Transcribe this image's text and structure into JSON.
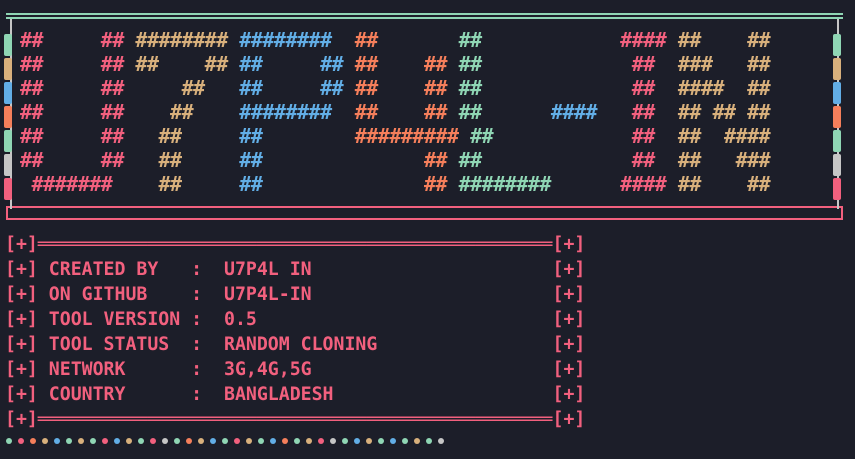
{
  "palette": {
    "background": "#1c1e29",
    "pink": "#f2607e",
    "tan": "#d8b07c",
    "blue": "#62aee6",
    "orange": "#f57f5b",
    "green": "#8fd6b4",
    "gray": "#c6c6c6",
    "accent": "#f2607e"
  },
  "side_bar_colors": [
    "#8fd6b4",
    "#d8b07c",
    "#62aee6",
    "#f57f5b",
    "#8fd6b4",
    "#c6c6c6",
    "#f2607e"
  ],
  "banner": {
    "rows": [
      [
        {
          "text": "##     ## ",
          "color": "#f2607e"
        },
        {
          "text": "######## ",
          "color": "#d8b07c"
        },
        {
          "text": "########  ",
          "color": "#62aee6"
        },
        {
          "text": "##       ",
          "color": "#f57f5b"
        },
        {
          "text": "##            ",
          "color": "#8fd6b4"
        },
        {
          "text": "####",
          "color": "#f2607e"
        },
        {
          "text": " ##    ##",
          "color": "#d8b07c"
        }
      ],
      [
        {
          "text": "##     ## ",
          "color": "#f2607e"
        },
        {
          "text": "##    ## ",
          "color": "#d8b07c"
        },
        {
          "text": "##     ## ",
          "color": "#62aee6"
        },
        {
          "text": "##    ## ",
          "color": "#f57f5b"
        },
        {
          "text": "##             ",
          "color": "#8fd6b4"
        },
        {
          "text": "##",
          "color": "#f2607e"
        },
        {
          "text": "  ###   ##",
          "color": "#d8b07c"
        }
      ],
      [
        {
          "text": "##     ## ",
          "color": "#f2607e"
        },
        {
          "text": "    ##   ",
          "color": "#d8b07c"
        },
        {
          "text": "##     ## ",
          "color": "#62aee6"
        },
        {
          "text": "##    ## ",
          "color": "#f57f5b"
        },
        {
          "text": "##             ",
          "color": "#8fd6b4"
        },
        {
          "text": "##",
          "color": "#f2607e"
        },
        {
          "text": "  ####  ##",
          "color": "#d8b07c"
        }
      ],
      [
        {
          "text": "##     ## ",
          "color": "#f2607e"
        },
        {
          "text": "   ##    ",
          "color": "#d8b07c"
        },
        {
          "text": "########  ",
          "color": "#62aee6"
        },
        {
          "text": "##    ## ",
          "color": "#f57f5b"
        },
        {
          "text": "##      ",
          "color": "#8fd6b4"
        },
        {
          "text": "####   ",
          "color": "#62aee6"
        },
        {
          "text": "##",
          "color": "#f2607e"
        },
        {
          "text": "  ## ## ##",
          "color": "#d8b07c"
        }
      ],
      [
        {
          "text": "##     ## ",
          "color": "#f2607e"
        },
        {
          "text": "  ##     ",
          "color": "#d8b07c"
        },
        {
          "text": "##        ",
          "color": "#62aee6"
        },
        {
          "text": "######### ",
          "color": "#f57f5b"
        },
        {
          "text": "##            ",
          "color": "#8fd6b4"
        },
        {
          "text": "##",
          "color": "#f2607e"
        },
        {
          "text": "  ##  ####",
          "color": "#d8b07c"
        }
      ],
      [
        {
          "text": "##     ## ",
          "color": "#f2607e"
        },
        {
          "text": "  ##     ",
          "color": "#d8b07c"
        },
        {
          "text": "##        ",
          "color": "#62aee6"
        },
        {
          "text": "      ## ",
          "color": "#f57f5b"
        },
        {
          "text": "##             ",
          "color": "#8fd6b4"
        },
        {
          "text": "##",
          "color": "#f2607e"
        },
        {
          "text": "  ##   ###",
          "color": "#d8b07c"
        }
      ],
      [
        {
          "text": " #######  ",
          "color": "#f2607e"
        },
        {
          "text": "  ##     ",
          "color": "#d8b07c"
        },
        {
          "text": "##        ",
          "color": "#62aee6"
        },
        {
          "text": "      ## ",
          "color": "#f57f5b"
        },
        {
          "text": "########      ",
          "color": "#8fd6b4"
        },
        {
          "text": "####",
          "color": "#f2607e"
        },
        {
          "text": " ##    ##",
          "color": "#d8b07c"
        }
      ]
    ]
  },
  "info": {
    "lines": [
      "[+]═══════════════════════════════════════════════[+]",
      "[+] CREATED BY   :  U7P4L IN                      [+]",
      "[+] ON GITHUB    :  U7P4L-IN                      [+]",
      "[+] TOOL VERSION :  0.5                           [+]",
      "[+] TOOL STATUS  :  RANDOM CLONING                [+]",
      "[+] NETWORK      :  3G,4G,5G                      [+]",
      "[+] COUNTRY      :  BANGLADESH                    [+]",
      "[+]═══════════════════════════════════════════════[+]"
    ]
  },
  "dot_colors": [
    "#8fd6b4",
    "#f2607e",
    "#f57f5b",
    "#d8b07c",
    "#62aee6",
    "#8fd6b4",
    "#d8b07c",
    "#8fd6b4",
    "#f2607e",
    "#62aee6",
    "#d8b07c",
    "#8fd6b4",
    "#f2607e",
    "#c6c6c6",
    "#8fd6b4",
    "#f57f5b",
    "#d8b07c",
    "#62aee6",
    "#8fd6b4",
    "#f2607e",
    "#d8b07c",
    "#8fd6b4",
    "#62aee6",
    "#f57f5b",
    "#8fd6b4",
    "#d8b07c",
    "#f2607e",
    "#c6c6c6",
    "#8fd6b4",
    "#62aee6",
    "#d8b07c",
    "#8fd6b4",
    "#62aee6",
    "#8fd6b4",
    "#d8b07c",
    "#8fd6b4",
    "#c6c6c6"
  ]
}
